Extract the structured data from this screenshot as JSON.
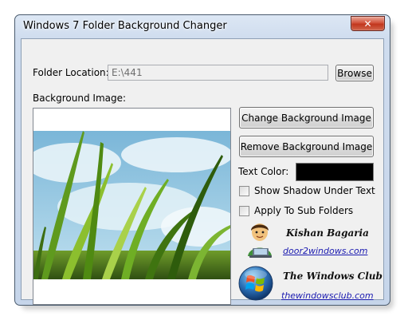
{
  "window": {
    "title": "Windows 7 Folder Background Changer",
    "close_glyph": "✕"
  },
  "folder": {
    "label": "Folder Location:",
    "value": "E:\\441",
    "browse_label": "Browse"
  },
  "background": {
    "label": "Background Image:"
  },
  "buttons": {
    "change_label": "Change Background Image",
    "remove_label": "Remove Background Image"
  },
  "text_color": {
    "label": "Text Color:",
    "value": "#000000"
  },
  "options": {
    "shadow_label": "Show Shadow Under Text",
    "shadow_checked": false,
    "subfolders_label": "Apply To Sub Folders",
    "subfolders_checked": false
  },
  "credits": {
    "author_name": "Kishan Bagaria",
    "author_link": "door2windows.com",
    "author_icon": "avatar-icon",
    "club_name": "The Windows Club",
    "club_link": "thewindowsclub.com",
    "club_icon": "windows-logo-icon"
  },
  "colors": {
    "accent_link": "#1a1ab0",
    "close_button": "#c1361d"
  }
}
